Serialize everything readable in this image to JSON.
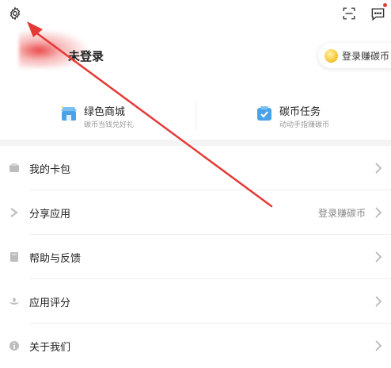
{
  "header": {
    "settings_icon": "gear-icon",
    "scan_icon": "scan-icon",
    "message_icon": "message-icon"
  },
  "profile": {
    "login_title": "未登录",
    "earn_button": "登录赚碳币"
  },
  "features": [
    {
      "title": "绿色商城",
      "subtitle": "碳币当钱兑好礼",
      "icon": "shop-icon"
    },
    {
      "title": "碳币任务",
      "subtitle": "动动手指赚碳币",
      "icon": "task-icon"
    }
  ],
  "menu": [
    {
      "label": "我的卡包",
      "hint": "",
      "icon": "wallet-icon"
    },
    {
      "label": "分享应用",
      "hint": "登录赚碳币",
      "icon": "share-icon"
    },
    {
      "label": "帮助与反馈",
      "hint": "",
      "icon": "help-icon"
    },
    {
      "label": "应用评分",
      "hint": "",
      "icon": "rate-icon"
    },
    {
      "label": "关于我们",
      "hint": "",
      "icon": "info-icon"
    }
  ],
  "colors": {
    "annotation": "#e53935",
    "accent_coin": "#f6c83a",
    "icon_blue": "#4aa3e8",
    "text_primary": "#222222",
    "text_secondary": "#999999"
  }
}
